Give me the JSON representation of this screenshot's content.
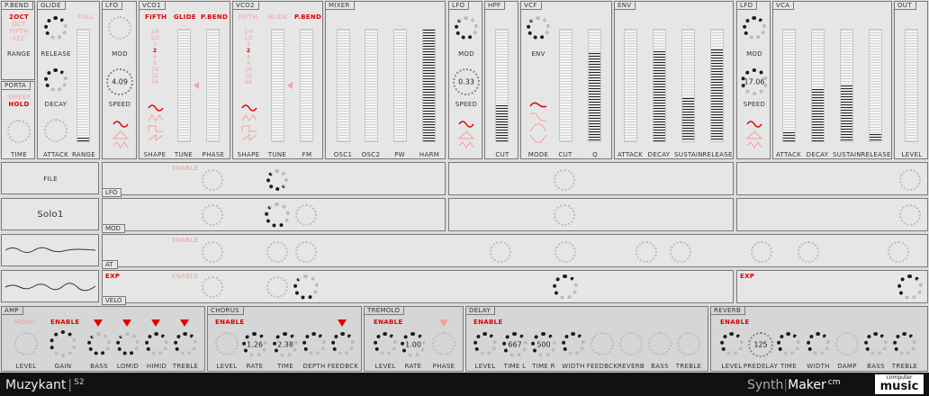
{
  "pbend": {
    "title": "P.BEND",
    "opts": [
      "2OCT",
      "OCT",
      "FIFTH",
      "SEC"
    ],
    "range": "RANGE"
  },
  "glide": {
    "title": "GLIDE",
    "full": "FULL",
    "release": "RELEASE",
    "decay": "DECAY",
    "attack": "ATTACK",
    "range": "RANGE"
  },
  "porta": {
    "title": "PORTA",
    "opts": [
      "SWEEP",
      "HOLD"
    ],
    "time": "TIME"
  },
  "lfo1": {
    "title": "LFO",
    "mod": "MOD",
    "value": "4.09",
    "speed": "SPEED"
  },
  "vco1": {
    "title": "VCO1",
    "top": [
      "FIFTH",
      "GLIDE",
      "P.BEND"
    ],
    "oct": [
      "1/4",
      "1/2",
      "1",
      "2",
      "4",
      "8",
      "16",
      "32",
      "64"
    ],
    "shape": "SHAPE",
    "tune": "TUNE",
    "phase": "PHASE"
  },
  "vco2": {
    "title": "VCO2",
    "top": [
      "FIFTH",
      "GLIDE",
      "P.BEND"
    ],
    "oct": [
      "1/4",
      "1/2",
      "1",
      "2",
      "4",
      "8",
      "16",
      "32",
      "64"
    ],
    "shape": "SHAPE",
    "tune": "TUNE",
    "fm": "FM"
  },
  "mixer": {
    "title": "MIXER",
    "labels": [
      "OSC1",
      "OSC2",
      "PW",
      "HARM"
    ]
  },
  "lfo2": {
    "title": "LFO",
    "mod": "MOD",
    "value": "0.33",
    "speed": "SPEED"
  },
  "hpf": {
    "title": "HPF",
    "cut": "CUT"
  },
  "vcf": {
    "title": "VCF",
    "env": "ENV",
    "mode": "MODE",
    "cut": "CUT",
    "q": "Q"
  },
  "env": {
    "title": "ENV",
    "labels": [
      "ATTACK",
      "DECAY",
      "SUSTAIN",
      "RELEASE"
    ]
  },
  "lfo3": {
    "title": "LFO",
    "mod": "MOD",
    "value": "17.06",
    "speed": "SPEED"
  },
  "vca": {
    "title": "VCA",
    "labels": [
      "ATTACK",
      "DECAY",
      "SUSTAIN",
      "RELEASE"
    ]
  },
  "out": {
    "title": "OUT",
    "level": "LEVEL"
  },
  "file": {
    "label": "FILE"
  },
  "preset": {
    "name": "Solo1"
  },
  "mods": {
    "lfo": "LFO",
    "mod": "MOD",
    "at": "AT",
    "velo": "VELO",
    "exp": "EXP",
    "enable": "ENABLE",
    "exp2": "EXP"
  },
  "amp": {
    "title": "AMP",
    "mono": "MONO",
    "enable": "ENABLE",
    "labels": [
      "LEVEL",
      "GAIN",
      "BASS",
      "LOMID",
      "HIMID",
      "TREBLE"
    ]
  },
  "chorus": {
    "title": "CHORUS",
    "enable": "ENABLE",
    "rate": "1.26",
    "time": "2.38",
    "labels": [
      "LEVEL",
      "RATE",
      "TIME",
      "DEPTH",
      "FEEDBCK"
    ]
  },
  "tremolo": {
    "title": "TREMOLO",
    "enable": "ENABLE",
    "rate": "1.00",
    "labels": [
      "LEVEL",
      "RATE",
      "PHASE"
    ]
  },
  "delay": {
    "title": "DELAY",
    "enable": "ENABLE",
    "timel": "667",
    "timer": "500",
    "labels": [
      "LEVEL",
      "TIME L",
      "TIME R",
      "WIDTH",
      "FEEDBCK",
      "REVERB",
      "BASS",
      "TREBLE"
    ]
  },
  "reverb": {
    "title": "REVERB",
    "enable": "ENABLE",
    "predelay": "125",
    "labels": [
      "LEVEL",
      "PREDELAY",
      "TIME",
      "WIDTH",
      "DAMP",
      "BASS",
      "TREBLE"
    ]
  },
  "footer": {
    "brand": "Muzykant",
    "brand_sup": "S2",
    "synth": "Synth",
    "maker": "Maker",
    "cm": "cm",
    "computer": "computer",
    "music": "music"
  },
  "colors": {
    "accent": "#e00000",
    "bg": "#e6e6e6",
    "border": "#7a7a7a"
  }
}
